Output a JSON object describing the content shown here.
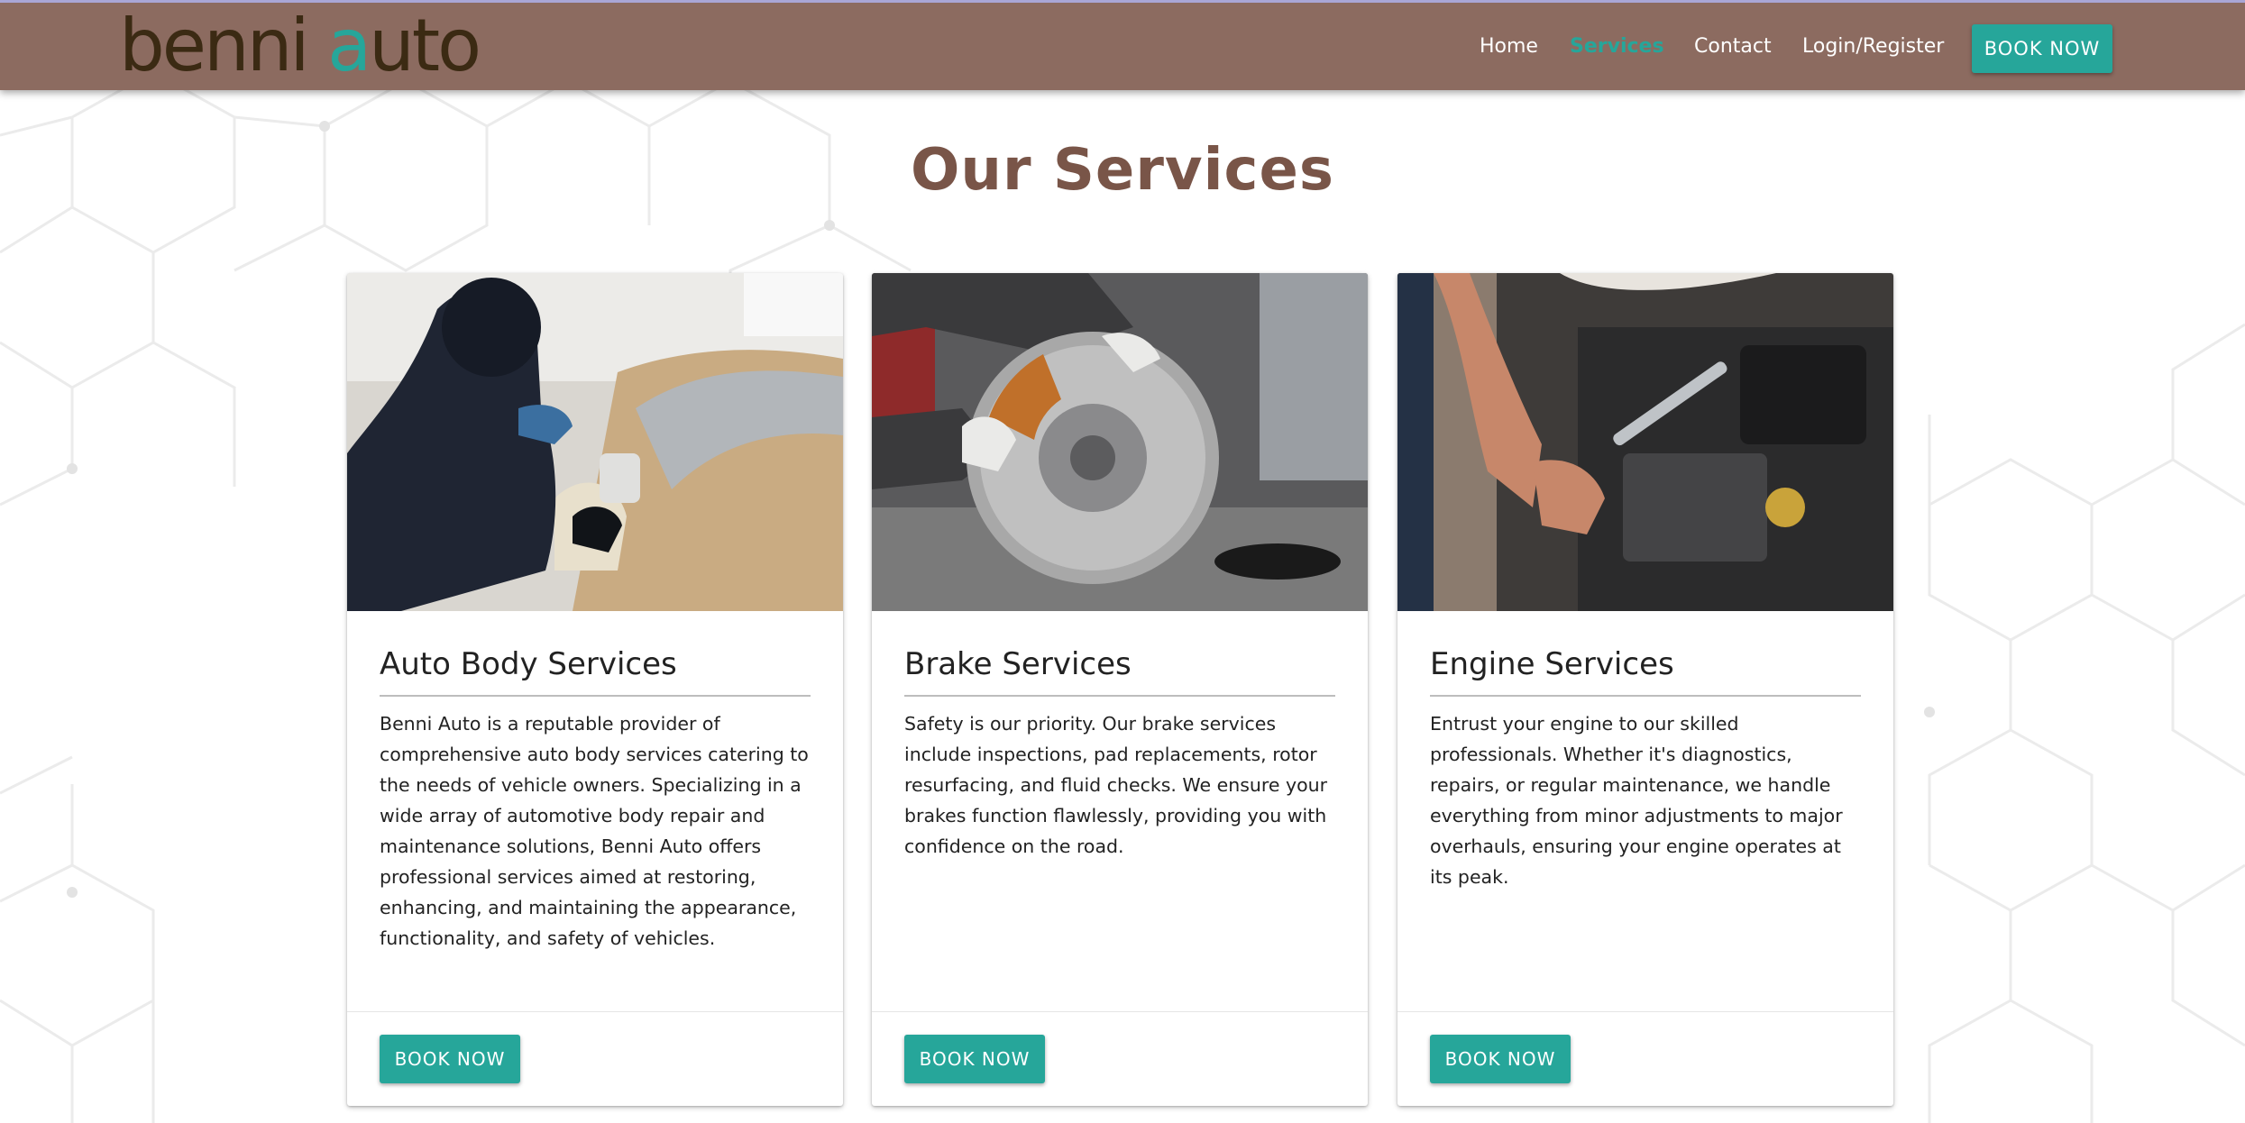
{
  "brand": {
    "logo_part1": "benni ",
    "logo_accent": "a",
    "logo_part2": "uto"
  },
  "nav": {
    "items": [
      {
        "label": "Home",
        "active": false
      },
      {
        "label": "Services",
        "active": true
      },
      {
        "label": "Contact",
        "active": false
      },
      {
        "label": "Login/Register",
        "active": false
      }
    ],
    "cta_label": "BOOK NOW"
  },
  "page": {
    "title": "Our Services"
  },
  "services": [
    {
      "title": "Auto Body Services",
      "description": "Benni Auto is a reputable provider of comprehensive auto body services catering to the needs of vehicle owners. Specializing in a wide array of automotive body repair and maintenance solutions, Benni Auto offers professional services aimed at restoring, enhancing, and maintaining the appearance, functionality, and safety of vehicles.",
      "button_label": "BOOK NOW",
      "image_icon": "spray-painting-photo"
    },
    {
      "title": "Brake Services",
      "description": "Safety is our priority. Our brake services include inspections, pad replacements, rotor resurfacing, and fluid checks. We ensure your brakes function flawlessly, providing you with confidence on the road.",
      "button_label": "BOOK NOW",
      "image_icon": "brake-rotor-photo"
    },
    {
      "title": "Engine Services",
      "description": "Entrust your engine to our skilled professionals. Whether it's diagnostics, repairs, or regular maintenance, we handle everything from minor adjustments to major overhauls, ensuring your engine operates at its peak.",
      "button_label": "BOOK NOW",
      "image_icon": "engine-repair-photo"
    }
  ],
  "colors": {
    "navbar": "#8c6b60",
    "accent": "#26a69a",
    "title": "#795548",
    "logo": "#3b2a13"
  }
}
